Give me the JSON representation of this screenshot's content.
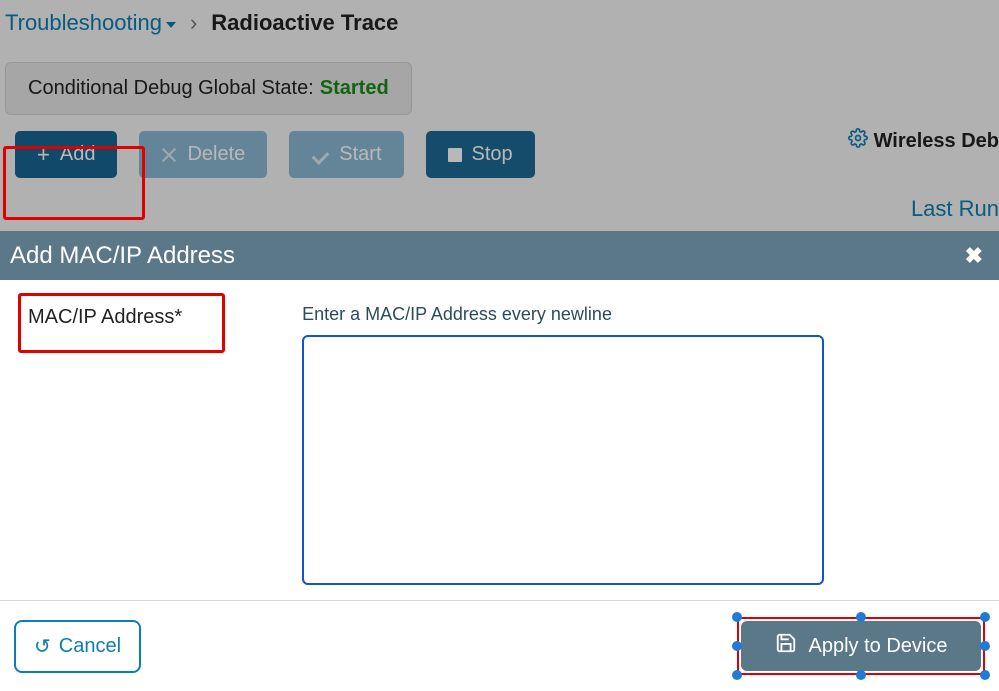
{
  "breadcrumb": {
    "root": "Troubleshooting",
    "current": "Radioactive Trace"
  },
  "status": {
    "label": "Conditional Debug Global State:",
    "value": "Started"
  },
  "toolbar": {
    "add": "Add",
    "delete": "Delete",
    "start": "Start",
    "stop": "Stop"
  },
  "links": {
    "wireless_debug": "Wireless Deb",
    "last_run": "Last Run"
  },
  "modal": {
    "title": "Add MAC/IP Address",
    "field_label": "MAC/IP Address*",
    "helper": "Enter a MAC/IP Address every newline",
    "input_value": "",
    "cancel": "Cancel",
    "apply": "Apply to Device"
  }
}
